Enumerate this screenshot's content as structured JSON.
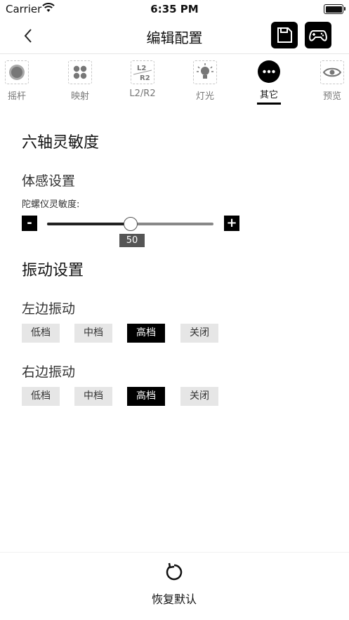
{
  "status_bar": {
    "carrier": "Carrier",
    "time": "6:35 PM"
  },
  "nav": {
    "title": "编辑配置",
    "save_icon": "save-icon",
    "gamepad_icon": "gamepad-icon"
  },
  "tabs": [
    {
      "label": "摇杆",
      "icon": "joystick-icon"
    },
    {
      "label": "映射",
      "icon": "mapping-icon"
    },
    {
      "label": "L2/R2",
      "icon": "l2r2-icon",
      "icon_text_top": "L2",
      "icon_text_bottom": "R2"
    },
    {
      "label": "灯光",
      "icon": "light-bulb-icon"
    },
    {
      "label": "其它",
      "icon": "more-icon",
      "active": true
    },
    {
      "label": "预览",
      "icon": "preview-eye-icon"
    }
  ],
  "six_axis": {
    "title": "六轴灵敏度",
    "motion_title": "体感设置",
    "gyro_label": "陀螺仪灵敏度:",
    "minus": "-",
    "plus": "+",
    "value": "50",
    "min": 0,
    "max": 100
  },
  "vibration": {
    "title": "振动设置",
    "left": {
      "title": "左边振动",
      "options": [
        "低档",
        "中档",
        "高档",
        "关闭"
      ],
      "selected": "高档"
    },
    "right": {
      "title": "右边振动",
      "options": [
        "低档",
        "中档",
        "高档",
        "关闭"
      ],
      "selected": "高档"
    }
  },
  "footer": {
    "restore_label": "恢复默认",
    "icon": "restore-icon"
  }
}
